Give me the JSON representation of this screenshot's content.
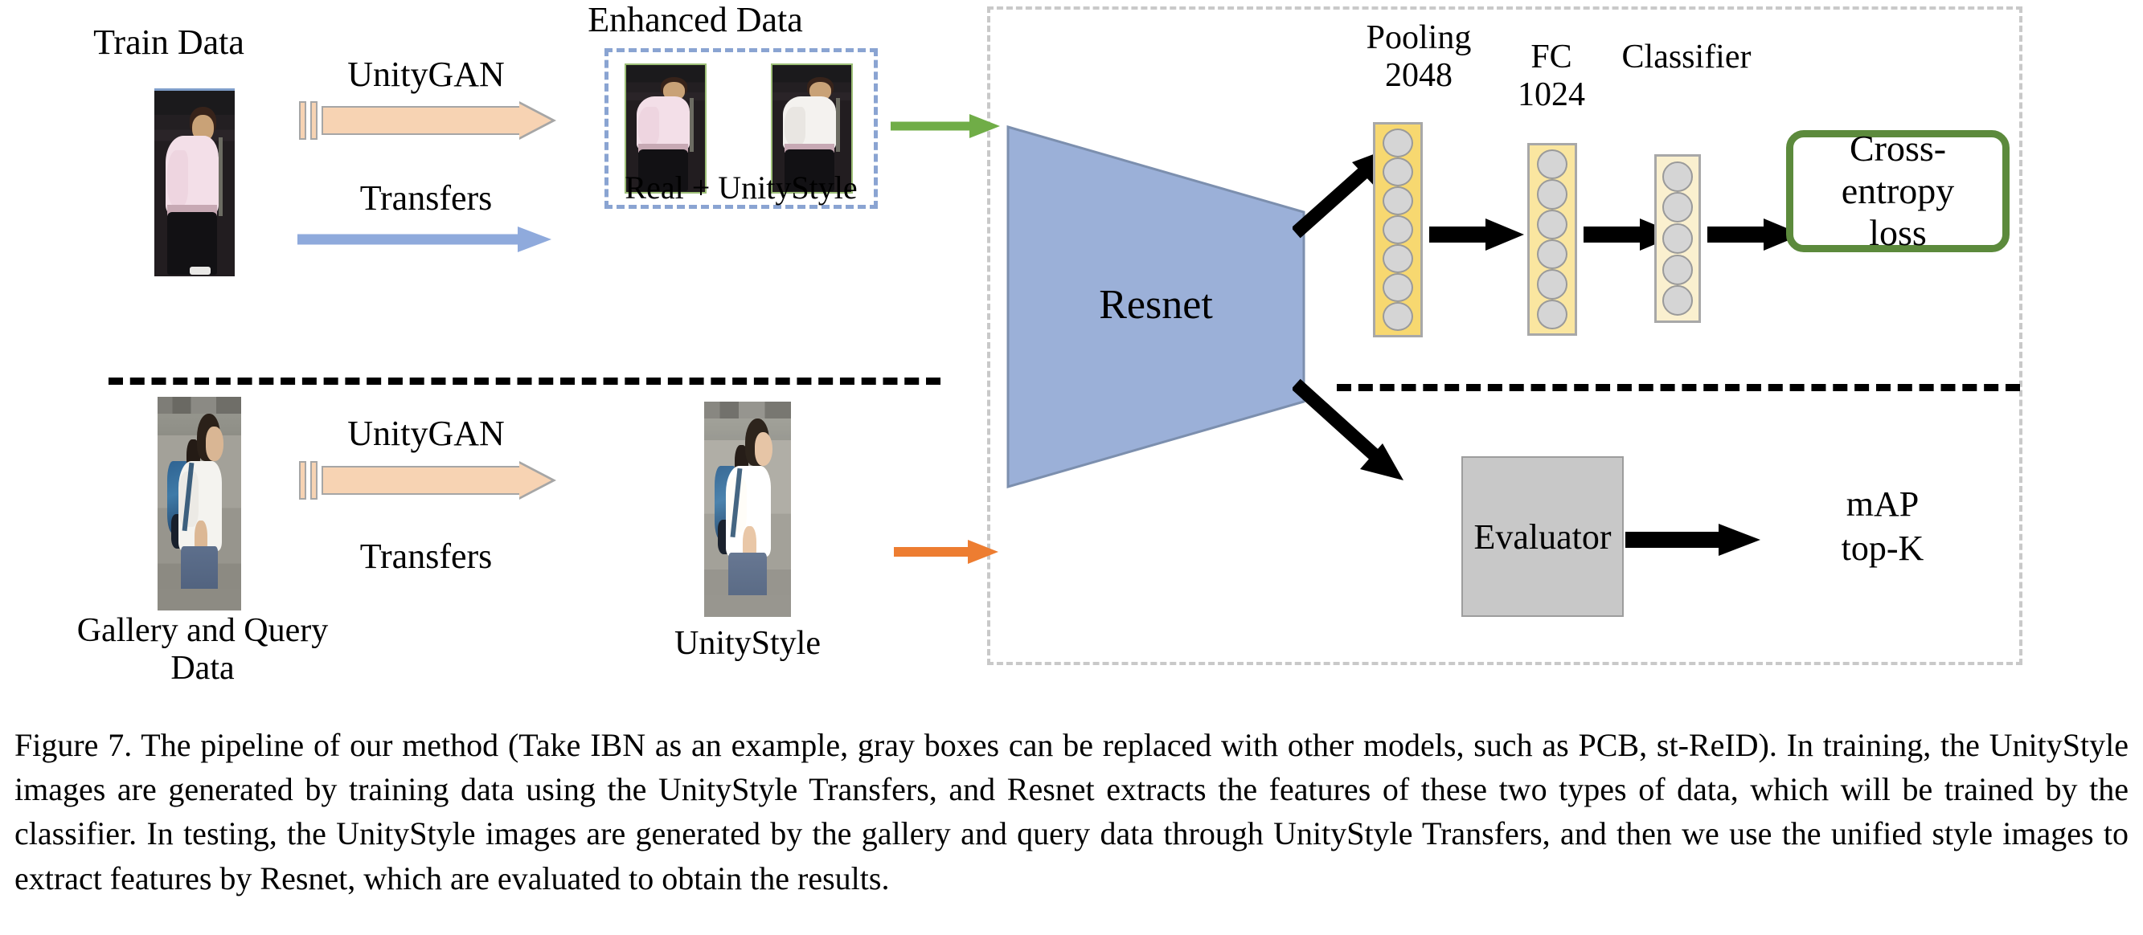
{
  "figure": {
    "caption": "Figure 7. The pipeline of our method (Take IBN as an example, gray boxes can be replaced with other models, such as PCB, st-ReID). In training, the UnityStyle images are generated by training data using the UnityStyle Transfers, and Resnet extracts the features of these two types of data, which will be trained by the classifier. In testing, the UnityStyle images are generated by the gallery and query data through UnityStyle Transfers, and then we use the unified style images to extract features by Resnet, which are evaluated to obtain the results."
  },
  "colors": {
    "peach_arrow": "#f7d3b3",
    "peach_arrow_border": "#a6a6a6",
    "blue_arrow": "#8faadc",
    "green_arrow": "#70ad47",
    "orange_arrow": "#ed7d31",
    "resnet_fill": "#9bb0d8",
    "resnet_border": "#7c8fae",
    "pooling_fill": "#f7d870",
    "fc_fill": "#fae6a0",
    "classifier_fill": "#faf0cf",
    "node_fill": "#d5d5d5",
    "loss_border": "#5c8a3c",
    "evaluator_fill": "#c8c8c8",
    "dashed_blue": "#8aa4d2",
    "dashed_gray": "#c9c9c9"
  },
  "training_branch": {
    "train_data_label": "Train Data",
    "transfer_arrow": {
      "top_label": "UnityGAN",
      "bottom_label": "Transfers",
      "icon": "transfer-arrow-icon"
    },
    "enhanced_data_label": "Enhanced Data",
    "enhanced_caption": "Real + UnityStyle",
    "enhanced_images": [
      {
        "name": "real-train-sample",
        "variant": "real"
      },
      {
        "name": "unitystyle-train-sample",
        "variant": "unitystyle"
      }
    ],
    "feed_arrow_color": "#70ad47"
  },
  "testing_branch": {
    "gallery_query_label": "Gallery and Query\nData",
    "transfer_arrow": {
      "top_label": "UnityGAN",
      "bottom_label": "Transfers",
      "icon": "transfer-arrow-icon"
    },
    "unitystyle_label": "UnityStyle",
    "feed_arrow_color": "#ed7d31"
  },
  "model": {
    "backbone_label": "Resnet",
    "layers": [
      {
        "id": "pooling",
        "title": "Pooling\n2048",
        "nodes": 7,
        "fill": "#f7d870"
      },
      {
        "id": "fc",
        "title": "FC\n1024",
        "nodes": 6,
        "fill": "#fae6a0"
      },
      {
        "id": "classifier",
        "title": "Classifier",
        "nodes": 5,
        "fill": "#faf0cf"
      }
    ],
    "loss_label": "Cross-entropy\nloss",
    "evaluator_label": "Evaluator",
    "metrics_label": "mAP\ntop-K"
  }
}
